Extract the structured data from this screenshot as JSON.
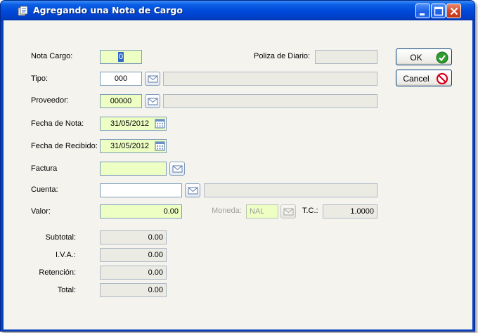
{
  "window": {
    "title": "Agregando una Nota de Cargo"
  },
  "form": {
    "nota_cargo": {
      "label": "Nota Cargo:",
      "value": "0"
    },
    "poliza": {
      "label": "Poliza de Diario:",
      "value": ""
    },
    "tipo": {
      "label": "Tipo:",
      "value": "000",
      "description": ""
    },
    "proveedor": {
      "label": "Proveedor:",
      "value": "00000",
      "description": ""
    },
    "fecha_nota": {
      "label": "Fecha de Nota:",
      "value": "31/05/2012"
    },
    "fecha_recibido": {
      "label": "Fecha de Recibido:",
      "value": "31/05/2012"
    },
    "factura": {
      "label": "Factura",
      "value": ""
    },
    "cuenta": {
      "label": "Cuenta:",
      "value": "",
      "description": ""
    },
    "valor": {
      "label": "Valor:",
      "value": "0.00"
    },
    "moneda": {
      "label": "Moneda:",
      "value": "NAL"
    },
    "tc": {
      "label": "T.C.:",
      "value": "1.0000"
    }
  },
  "totals": {
    "subtotal": {
      "label": "Subtotal:",
      "value": "0.00"
    },
    "iva": {
      "label": "I.V.A.:",
      "value": "0.00"
    },
    "retencion": {
      "label": "Retención:",
      "value": "0.00"
    },
    "total": {
      "label": "Total:",
      "value": "0.00"
    }
  },
  "buttons": {
    "ok": "OK",
    "cancel": "Cancel"
  },
  "colors": {
    "required_field": "#eeffc4",
    "readonly_field": "#ebebe4",
    "titlebar": "#0048d8",
    "ok_icon": "#2e9b2e",
    "cancel_icon": "#d8001c"
  },
  "icons": {
    "app": "document-icon",
    "lookup": "envelope-dropdown-icon",
    "calendar": "calendar-icon",
    "ok": "checkmark-icon",
    "cancel": "no-entry-icon"
  }
}
